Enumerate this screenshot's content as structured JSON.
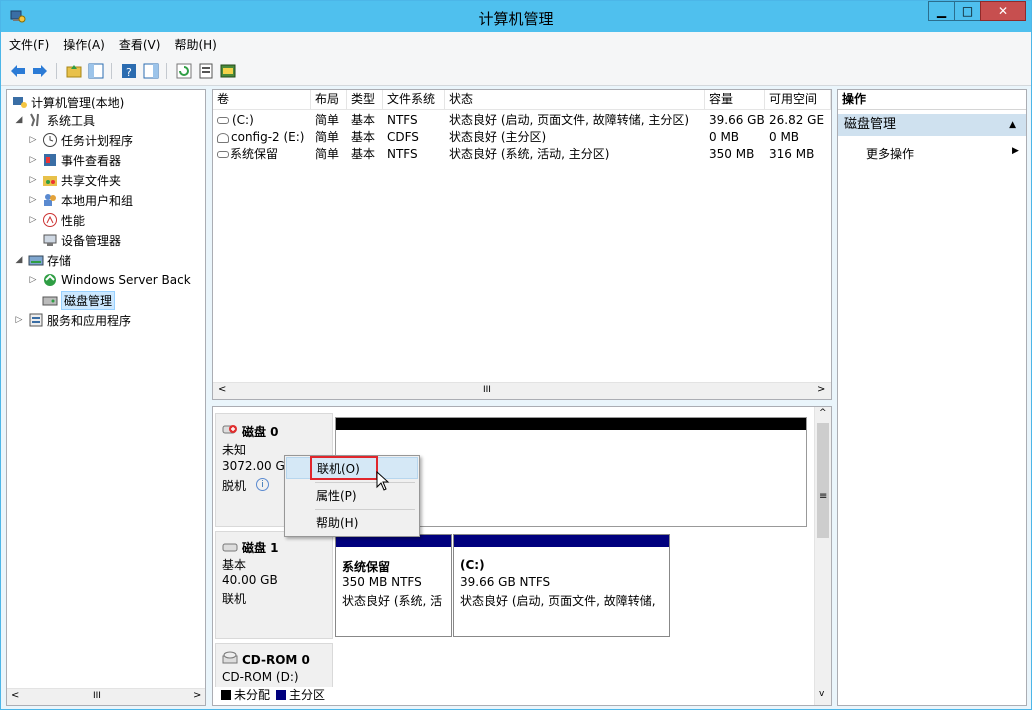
{
  "window": {
    "title": "计算机管理"
  },
  "menu": [
    "文件(F)",
    "操作(A)",
    "查看(V)",
    "帮助(H)"
  ],
  "tree": [
    {
      "label": "计算机管理(本地)",
      "arrow": "",
      "icon": "computer-mgmt-icon"
    },
    {
      "label": "系统工具",
      "arrow": "◢",
      "icon": "system-tools-icon"
    },
    {
      "label": "任务计划程序",
      "arrow": "▷",
      "icon": "task-scheduler-icon"
    },
    {
      "label": "事件查看器",
      "arrow": "▷",
      "icon": "event-viewer-icon"
    },
    {
      "label": "共享文件夹",
      "arrow": "▷",
      "icon": "shared-folder-icon"
    },
    {
      "label": "本地用户和组",
      "arrow": "▷",
      "icon": "users-icon"
    },
    {
      "label": "性能",
      "arrow": "▷",
      "icon": "performance-icon"
    },
    {
      "label": "设备管理器",
      "arrow": "",
      "icon": "device-manager-icon"
    },
    {
      "label": "存储",
      "arrow": "◢",
      "icon": "storage-icon"
    },
    {
      "label": "Windows Server Back",
      "arrow": "▷",
      "icon": "backup-icon"
    },
    {
      "label": "磁盘管理",
      "arrow": "",
      "icon": "disk-mgmt-icon"
    },
    {
      "label": "服务和应用程序",
      "arrow": "▷",
      "icon": "services-icon"
    }
  ],
  "volumes": {
    "headers": [
      "卷",
      "布局",
      "类型",
      "文件系统",
      "状态",
      "容量",
      "可用空间"
    ],
    "rows": [
      [
        "(C:)",
        "简单",
        "基本",
        "NTFS",
        "状态良好 (启动, 页面文件, 故障转储, 主分区)",
        "39.66 GB",
        "26.82 GE"
      ],
      [
        "config-2 (E:)",
        "简单",
        "基本",
        "CDFS",
        "状态良好 (主分区)",
        "0 MB",
        "0 MB"
      ],
      [
        "系统保留",
        "简单",
        "基本",
        "NTFS",
        "状态良好 (系统, 活动, 主分区)",
        "350 MB",
        "316 MB"
      ]
    ],
    "scroll_glyph": "III"
  },
  "disks": {
    "disk0": {
      "name": "磁盘 0",
      "type": "未知",
      "size": "3072.00 G",
      "status": "脱机"
    },
    "disk1": {
      "name": "磁盘 1",
      "type": "基本",
      "size": "40.00 GB",
      "status": "联机",
      "partitions": [
        {
          "name": "系统保留",
          "fs": "350 MB NTFS",
          "status": "状态良好 (系统, 活"
        },
        {
          "name": "(C:)",
          "fs": "39.66 GB NTFS",
          "status": "状态良好 (启动, 页面文件, 故障转储,"
        }
      ]
    },
    "cdrom": {
      "name": "CD-ROM 0",
      "drive": "CD-ROM (D:)"
    }
  },
  "legend": [
    "未分配",
    "主分区"
  ],
  "actions": {
    "title": "操作",
    "group": "磁盘管理",
    "item": "更多操作"
  },
  "context_menu": [
    "联机(O)",
    "属性(P)",
    "帮助(H)"
  ],
  "tree_scroll_glyph": "III",
  "colors": {
    "titlebar": "#4fc0ee",
    "primary_partition": "#00007e",
    "unallocated": "#000000"
  }
}
